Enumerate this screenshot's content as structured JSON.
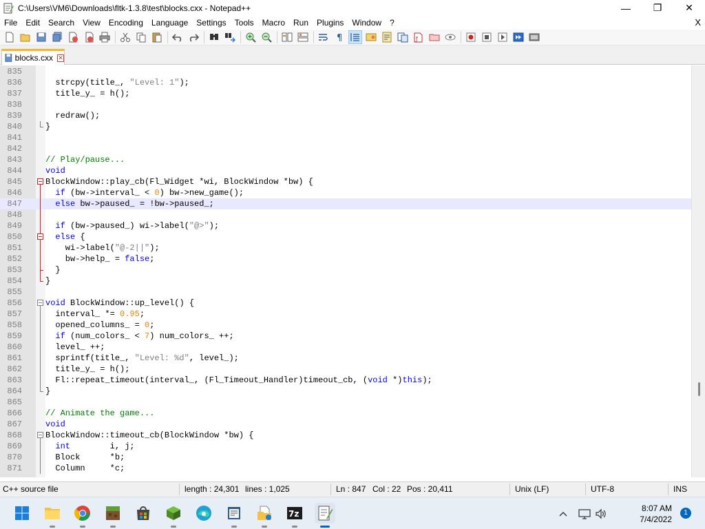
{
  "window": {
    "title": "C:\\Users\\VM6\\Downloads\\fltk-1.3.8\\test\\blocks.cxx - Notepad++",
    "minimize": "—",
    "maximize": "❐",
    "close": "✕"
  },
  "menu": {
    "items": [
      "File",
      "Edit",
      "Search",
      "View",
      "Encoding",
      "Language",
      "Settings",
      "Tools",
      "Macro",
      "Run",
      "Plugins",
      "Window",
      "?"
    ],
    "close": "X"
  },
  "toolbar": {
    "icons": [
      "new-file-icon",
      "open-file-icon",
      "save-icon",
      "save-all-icon",
      "close-icon",
      "close-all-icon",
      "print-icon",
      "cut-icon",
      "copy-icon",
      "paste-icon",
      "undo-icon",
      "redo-icon",
      "find-icon",
      "replace-icon",
      "zoom-in-icon",
      "zoom-out-icon",
      "sync-vertical-icon",
      "sync-horizontal-icon",
      "word-wrap-icon",
      "show-all-chars-icon",
      "indent-guide-icon",
      "user-defined-language-icon",
      "doc-map-icon",
      "function-list-icon",
      "folder-workspace-icon",
      "monitoring-icon",
      "record-macro-icon",
      "stop-macro-icon",
      "play-macro-icon",
      "run-macro-multiple-icon",
      "save-macro-icon"
    ]
  },
  "tab": {
    "label": "blocks.cxx"
  },
  "editor": {
    "current_line": 847,
    "lines": [
      {
        "n": "835",
        "code": ""
      },
      {
        "n": "836",
        "code": "  strcpy(title_, \"Level: 1\");"
      },
      {
        "n": "837",
        "code": "  title_y_ = h();"
      },
      {
        "n": "838",
        "code": ""
      },
      {
        "n": "839",
        "code": "  redraw();"
      },
      {
        "n": "840",
        "code": "}"
      },
      {
        "n": "841",
        "code": ""
      },
      {
        "n": "842",
        "code": ""
      },
      {
        "n": "843",
        "code": "// Play/pause..."
      },
      {
        "n": "844",
        "code": "void"
      },
      {
        "n": "845",
        "code": "BlockWindow::play_cb(Fl_Widget *wi, BlockWindow *bw) {"
      },
      {
        "n": "846",
        "code": "  if (bw->interval_ < 0) bw->new_game();"
      },
      {
        "n": "847",
        "code": "  else bw->paused_ = !bw->paused_;"
      },
      {
        "n": "848",
        "code": ""
      },
      {
        "n": "849",
        "code": "  if (bw->paused_) wi->label(\"@>\");"
      },
      {
        "n": "850",
        "code": "  else {"
      },
      {
        "n": "851",
        "code": "    wi->label(\"@-2||\");"
      },
      {
        "n": "852",
        "code": "    bw->help_ = false;"
      },
      {
        "n": "853",
        "code": "  }"
      },
      {
        "n": "854",
        "code": "}"
      },
      {
        "n": "855",
        "code": ""
      },
      {
        "n": "856",
        "code": "void BlockWindow::up_level() {"
      },
      {
        "n": "857",
        "code": "  interval_ *= 0.95;"
      },
      {
        "n": "858",
        "code": "  opened_columns_ = 0;"
      },
      {
        "n": "859",
        "code": "  if (num_colors_ < 7) num_colors_ ++;"
      },
      {
        "n": "860",
        "code": "  level_ ++;"
      },
      {
        "n": "861",
        "code": "  sprintf(title_, \"Level: %d\", level_);"
      },
      {
        "n": "862",
        "code": "  title_y_ = h();"
      },
      {
        "n": "863",
        "code": "  Fl::repeat_timeout(interval_, (Fl_Timeout_Handler)timeout_cb, (void *)this);"
      },
      {
        "n": "864",
        "code": "}"
      },
      {
        "n": "865",
        "code": ""
      },
      {
        "n": "866",
        "code": "// Animate the game..."
      },
      {
        "n": "867",
        "code": "void"
      },
      {
        "n": "868",
        "code": "BlockWindow::timeout_cb(BlockWindow *bw) {"
      },
      {
        "n": "869",
        "code": "  int        i, j;"
      },
      {
        "n": "870",
        "code": "  Block      *b;"
      },
      {
        "n": "871",
        "code": "  Column     *c;"
      }
    ]
  },
  "status": {
    "filetype": "C++ source file",
    "length": "length : 24,301",
    "lines": "lines : 1,025",
    "ln": "Ln : 847",
    "col": "Col : 22",
    "pos": "Pos : 20,411",
    "eol": "Unix (LF)",
    "encoding": "UTF-8",
    "mode": "INS"
  },
  "taskbar": {
    "apps": [
      "windows-start-icon",
      "file-explorer-icon",
      "chrome-icon",
      "minecraft-icon",
      "store-icon",
      "minecraft-launcher-icon",
      "edge-icon",
      "notepad-window-icon",
      "file-manager-icon",
      "7zip-icon",
      "notepad-plus-plus-icon"
    ],
    "time": "8:07 AM",
    "date": "7/4/2022",
    "notifications": "1"
  },
  "colors": {
    "keyword": "#0000ff",
    "string": "#808080",
    "number": "#ff8000",
    "comment": "#008000",
    "current_line": "#e8e8ff",
    "tab_accent": "#f7b431"
  }
}
